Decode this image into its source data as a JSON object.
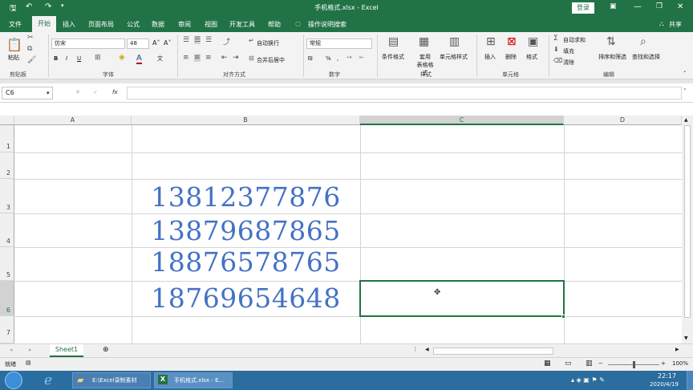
{
  "window": {
    "title": "手机格式.xlsx - Excel",
    "login_label": "登录",
    "controls": [
      "save-icon",
      "undo-icon",
      "redo-icon",
      "customize-icon"
    ]
  },
  "tabs": [
    "文件",
    "开始",
    "插入",
    "页面布局",
    "公式",
    "数据",
    "审阅",
    "视图",
    "开发工具",
    "帮助"
  ],
  "tell_me": "操作说明搜索",
  "share_label": "共享",
  "ribbon": {
    "clipboard": {
      "paste": "粘贴",
      "group": "剪贴板"
    },
    "font": {
      "name": "仿宋",
      "size": "48",
      "group": "字体"
    },
    "alignment": {
      "wrap": "自动换行",
      "merge": "合并后居中",
      "group": "对齐方式"
    },
    "number": {
      "format": "常规",
      "group": "数字"
    },
    "styles": {
      "conditional": "条件格式",
      "table": "套用\n表格格式",
      "cell": "单元格样式",
      "group": "样式"
    },
    "cells": {
      "insert": "插入",
      "delete": "删除",
      "format": "格式",
      "group": "单元格"
    },
    "editing": {
      "autosum": "自动求和",
      "fill": "填充",
      "clear": "清除",
      "sort": "排序和筛选",
      "find": "查找和选择",
      "group": "编辑"
    }
  },
  "formula": {
    "name_box": "C6",
    "fx": "fx",
    "value": ""
  },
  "columns": [
    "A",
    "B",
    "C",
    "D"
  ],
  "rows": [
    "1",
    "2",
    "3",
    "4",
    "5",
    "6",
    "7"
  ],
  "cells": {
    "B3": "13812377876",
    "B4": "13879687865",
    "B5": "18876578765",
    "B6": "18769654648"
  },
  "sheet": {
    "tab": "Sheet1"
  },
  "status": {
    "mode": "就绪",
    "zoom": "100%"
  },
  "taskbar": {
    "items": [
      "E:\\Excel录制素材",
      "手机格式.xlsx - E..."
    ],
    "time": "22:17",
    "date": "2020/4/19"
  },
  "colors": {
    "accent": "#217346",
    "numbers": "#4472c4"
  }
}
